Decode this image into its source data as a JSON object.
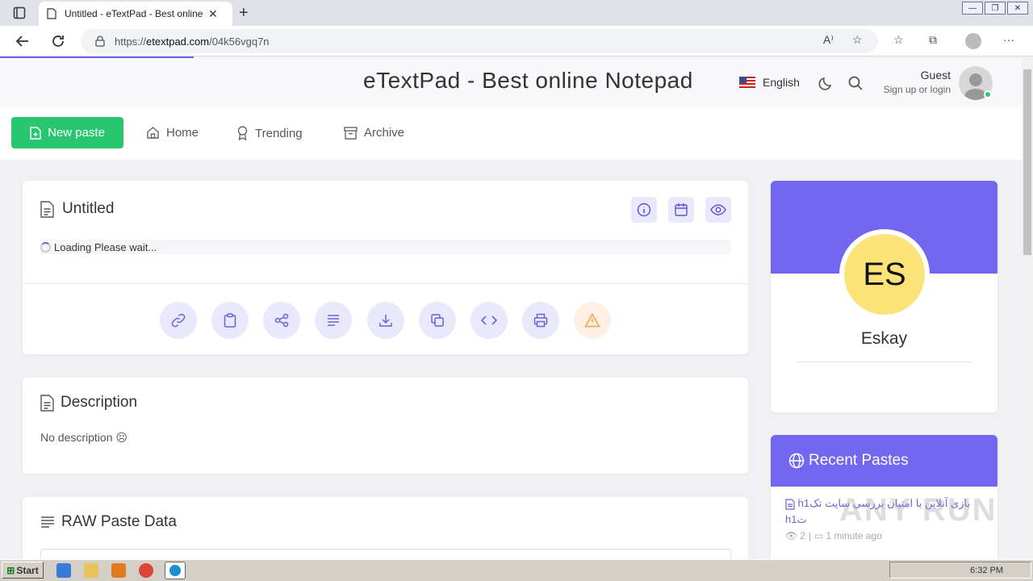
{
  "browser": {
    "tab_title": "Untitled - eTextPad - Best online Notepad",
    "url_prefix": "https://",
    "url_host": "etextpad.com",
    "url_path": "/04k56vgq7n"
  },
  "site": {
    "title": "eTextPad - Best online Notepad",
    "language": "English",
    "user_name": "Guest",
    "user_sub": "Sign up or login"
  },
  "nav": {
    "new_paste": "New paste",
    "home": "Home",
    "trending": "Trending",
    "archive": "Archive"
  },
  "paste": {
    "title": "Untitled",
    "loading": "Loading Please wait..."
  },
  "description": {
    "heading": "Description",
    "text": "No description ☹"
  },
  "raw": {
    "heading": "RAW Paste Data"
  },
  "profile": {
    "initials": "ES",
    "name": "Eskay"
  },
  "recent": {
    "heading": "Recent Pastes",
    "item_title": "h1بازی آنلاین با امتیان بررسی سایت تک h1ت",
    "item_views": "2",
    "item_time": "1 minute ago"
  },
  "watermark": "ANY RUN",
  "taskbar": {
    "start": "Start",
    "clock": "6:32 PM"
  },
  "colors": {
    "accent": "#7367f0",
    "success": "#28c76f",
    "warning": "#ff9f43"
  }
}
